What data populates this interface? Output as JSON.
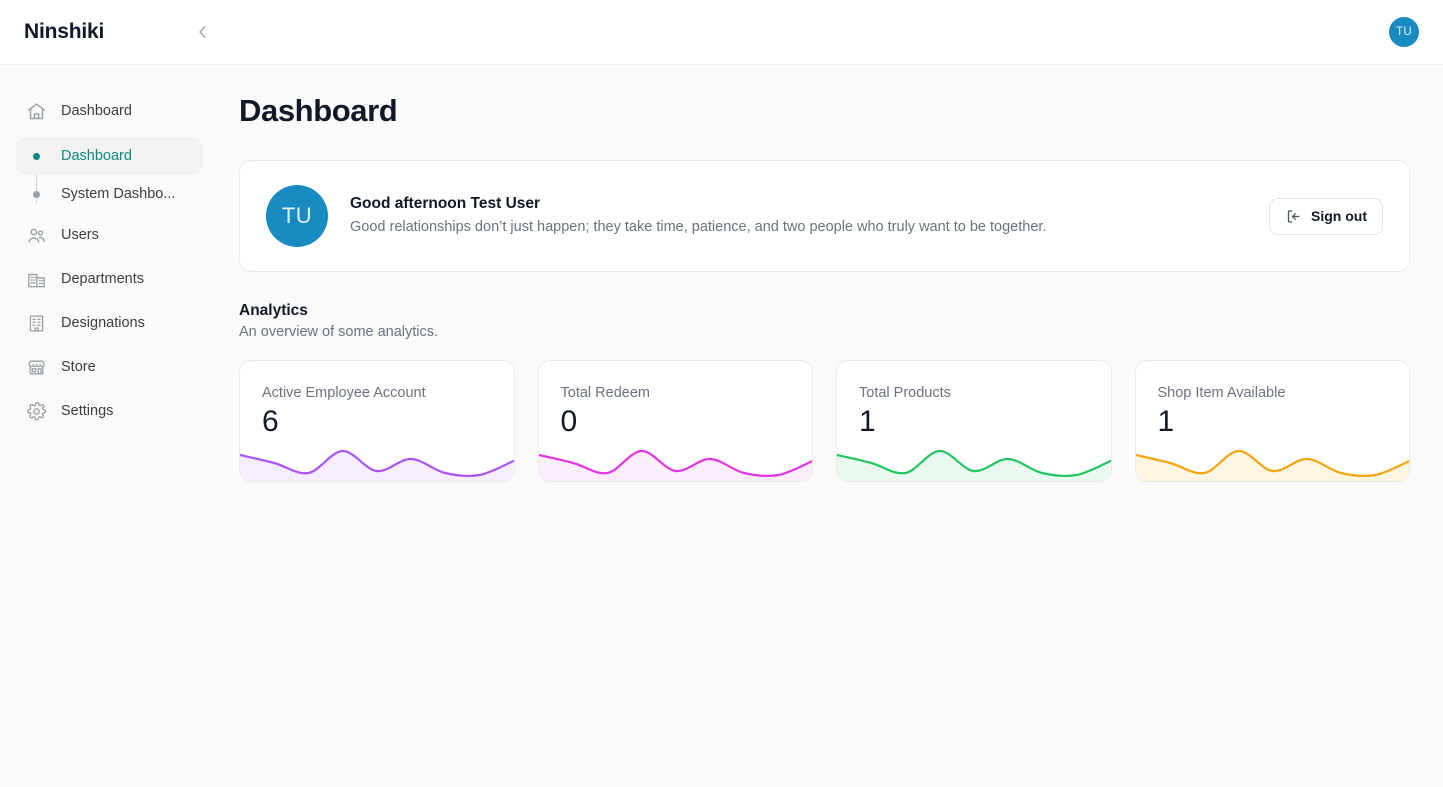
{
  "topbar": {
    "brand": "Ninshiki",
    "collapse_icon": "chevron-left-icon",
    "avatar_initials": "TU"
  },
  "sidebar": {
    "items": [
      {
        "label": "Dashboard",
        "icon": "home-icon",
        "type": "link"
      },
      {
        "label": "Users",
        "icon": "users-icon",
        "type": "link"
      },
      {
        "label": "Departments",
        "icon": "building-icon",
        "type": "link"
      },
      {
        "label": "Designations",
        "icon": "office-building-icon",
        "type": "link"
      },
      {
        "label": "Store",
        "icon": "store-icon",
        "type": "link"
      },
      {
        "label": "Settings",
        "icon": "gear-icon",
        "type": "link"
      }
    ],
    "subitems": [
      {
        "label": "Dashboard",
        "active": true
      },
      {
        "label": "System Dashbo...",
        "active": false
      }
    ],
    "active_color": "#0f8a7e"
  },
  "main": {
    "page_title": "Dashboard",
    "greeting": {
      "avatar_initials": "TU",
      "title": "Good afternoon Test User",
      "subtitle": "Good relationships don’t just happen; they take time, patience, and two people who truly want to be together.",
      "signout_label": "Sign out",
      "signout_icon": "sign-out-icon"
    },
    "analytics": {
      "title": "Analytics",
      "subtitle": "An overview of some analytics."
    }
  },
  "chart_data": [
    {
      "type": "area",
      "title": "Active Employee Account",
      "value": "6",
      "color": "#a855f7",
      "fill": "#f6edfd",
      "x": [
        0,
        1,
        2,
        3,
        4,
        5,
        6,
        7,
        8
      ],
      "values": [
        26,
        18,
        8,
        30,
        10,
        22,
        8,
        6,
        20
      ],
      "ylim": [
        0,
        44
      ],
      "grid": false,
      "legend": false
    },
    {
      "type": "area",
      "title": "Total Redeem",
      "value": "0",
      "color": "#e334e3",
      "fill": "#fbeefb",
      "x": [
        0,
        1,
        2,
        3,
        4,
        5,
        6,
        7,
        8
      ],
      "values": [
        26,
        18,
        8,
        30,
        10,
        22,
        8,
        6,
        20
      ],
      "ylim": [
        0,
        44
      ],
      "grid": false,
      "legend": false
    },
    {
      "type": "area",
      "title": "Total Products",
      "value": "1",
      "color": "#22c55e",
      "fill": "#e9f9ef",
      "x": [
        0,
        1,
        2,
        3,
        4,
        5,
        6,
        7,
        8
      ],
      "values": [
        26,
        18,
        8,
        30,
        10,
        22,
        8,
        6,
        20
      ],
      "ylim": [
        0,
        44
      ],
      "grid": false,
      "legend": false
    },
    {
      "type": "area",
      "title": "Shop Item Available",
      "value": "1",
      "color": "#f5a40c",
      "fill": "#fdf6e3",
      "x": [
        0,
        1,
        2,
        3,
        4,
        5,
        6,
        7,
        8
      ],
      "values": [
        26,
        18,
        8,
        30,
        10,
        22,
        8,
        6,
        20
      ],
      "ylim": [
        0,
        44
      ],
      "grid": false,
      "legend": false
    }
  ]
}
